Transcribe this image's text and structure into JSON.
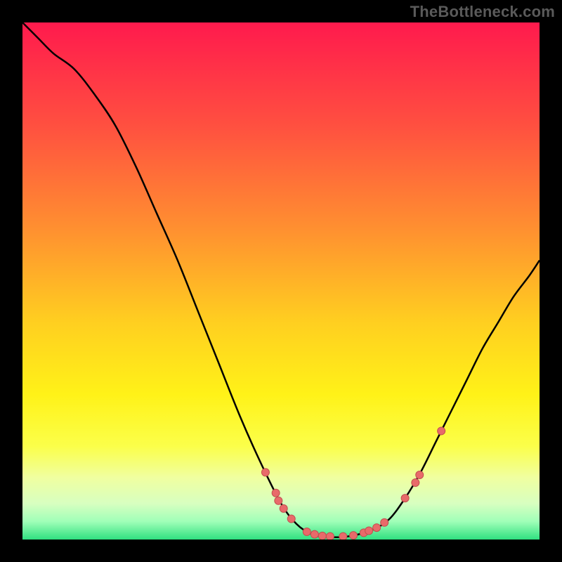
{
  "watermark": "TheBottleneck.com",
  "chart_data": {
    "type": "line",
    "title": "",
    "xlabel": "",
    "ylabel": "",
    "xlim": [
      0,
      100
    ],
    "ylim": [
      0,
      100
    ],
    "curve": [
      {
        "x": 0,
        "y": 100
      },
      {
        "x": 3,
        "y": 97
      },
      {
        "x": 6,
        "y": 94
      },
      {
        "x": 10,
        "y": 91
      },
      {
        "x": 14,
        "y": 86
      },
      {
        "x": 18,
        "y": 80
      },
      {
        "x": 22,
        "y": 72
      },
      {
        "x": 26,
        "y": 63
      },
      {
        "x": 30,
        "y": 54
      },
      {
        "x": 34,
        "y": 44
      },
      {
        "x": 38,
        "y": 34
      },
      {
        "x": 42,
        "y": 24
      },
      {
        "x": 46,
        "y": 15
      },
      {
        "x": 50,
        "y": 7
      },
      {
        "x": 53,
        "y": 3
      },
      {
        "x": 56,
        "y": 1
      },
      {
        "x": 59,
        "y": 0.5
      },
      {
        "x": 62,
        "y": 0.5
      },
      {
        "x": 65,
        "y": 1
      },
      {
        "x": 68,
        "y": 2
      },
      {
        "x": 71,
        "y": 4
      },
      {
        "x": 74,
        "y": 8
      },
      {
        "x": 77,
        "y": 13
      },
      {
        "x": 80,
        "y": 19
      },
      {
        "x": 83,
        "y": 25
      },
      {
        "x": 86,
        "y": 31
      },
      {
        "x": 89,
        "y": 37
      },
      {
        "x": 92,
        "y": 42
      },
      {
        "x": 95,
        "y": 47
      },
      {
        "x": 98,
        "y": 51
      },
      {
        "x": 100,
        "y": 54
      }
    ],
    "markers": [
      {
        "x": 47,
        "y": 13
      },
      {
        "x": 49,
        "y": 9
      },
      {
        "x": 49.5,
        "y": 7.5
      },
      {
        "x": 50.5,
        "y": 6
      },
      {
        "x": 52,
        "y": 4
      },
      {
        "x": 55,
        "y": 1.5
      },
      {
        "x": 56.5,
        "y": 1
      },
      {
        "x": 58,
        "y": 0.7
      },
      {
        "x": 59.5,
        "y": 0.6
      },
      {
        "x": 62,
        "y": 0.6
      },
      {
        "x": 64,
        "y": 0.8
      },
      {
        "x": 66,
        "y": 1.3
      },
      {
        "x": 67,
        "y": 1.7
      },
      {
        "x": 68.5,
        "y": 2.3
      },
      {
        "x": 70,
        "y": 3.3
      },
      {
        "x": 74,
        "y": 8
      },
      {
        "x": 76,
        "y": 11
      },
      {
        "x": 76.8,
        "y": 12.5
      },
      {
        "x": 81,
        "y": 21
      }
    ],
    "gradient_stops": [
      {
        "offset": 0.0,
        "color": "#ff1a4d"
      },
      {
        "offset": 0.2,
        "color": "#ff5040"
      },
      {
        "offset": 0.4,
        "color": "#ff9030"
      },
      {
        "offset": 0.58,
        "color": "#ffcf20"
      },
      {
        "offset": 0.72,
        "color": "#fff218"
      },
      {
        "offset": 0.82,
        "color": "#fbff4a"
      },
      {
        "offset": 0.88,
        "color": "#f0ffa0"
      },
      {
        "offset": 0.93,
        "color": "#d8ffc0"
      },
      {
        "offset": 0.965,
        "color": "#a0ffb8"
      },
      {
        "offset": 1.0,
        "color": "#30e080"
      }
    ],
    "colors": {
      "curve": "#000000",
      "marker_fill": "#e86a6a",
      "marker_stroke": "#c24f4f",
      "background": "#000000"
    }
  }
}
